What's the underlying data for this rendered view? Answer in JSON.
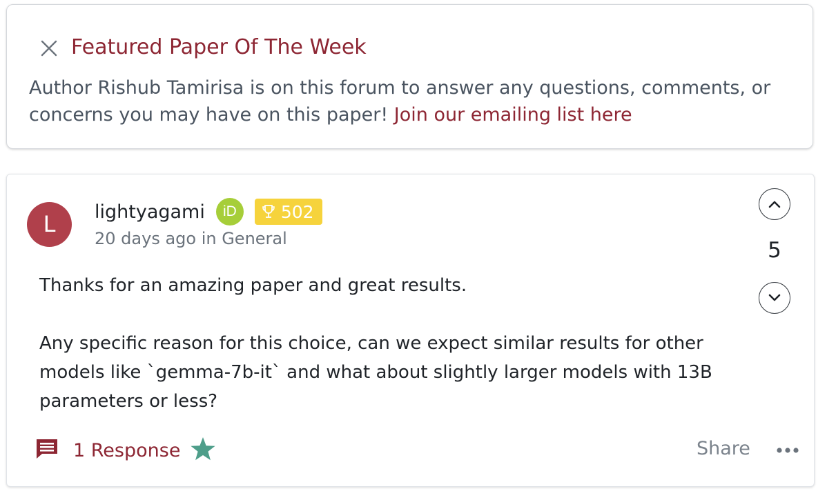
{
  "banner": {
    "close_icon": "close-icon",
    "title": "Featured Paper Of The Week",
    "body_text": "Author Rishub Tamirisa is on this forum to answer any questions, comments, or concerns you may have on this paper! ",
    "link_text": "Join our emailing list here"
  },
  "post": {
    "avatar_letter": "L",
    "author": "lightyagami",
    "orcid_label": "iD",
    "reputation": "502",
    "meta": "20 days ago in General",
    "paragraphs": [
      "Thanks for an amazing paper and great results.",
      "Any specific reason for this choice, can we expect similar results for other models like `gemma-7b-it` and what about slightly larger models with 13B parameters or less?"
    ],
    "votes": "5",
    "responses_label": "1 Response",
    "share_label": "Share",
    "more_label": "•••"
  },
  "colors": {
    "accent": "#8d2633",
    "avatar_bg": "#b0404b",
    "orcid_green": "#a6ce39",
    "badge_yellow": "#f6d33c",
    "star_teal": "#4e9e8a"
  },
  "icons": [
    "close-icon",
    "trophy-icon",
    "chevron-up-icon",
    "chevron-down-icon",
    "comment-icon",
    "star-icon",
    "more-icon"
  ]
}
